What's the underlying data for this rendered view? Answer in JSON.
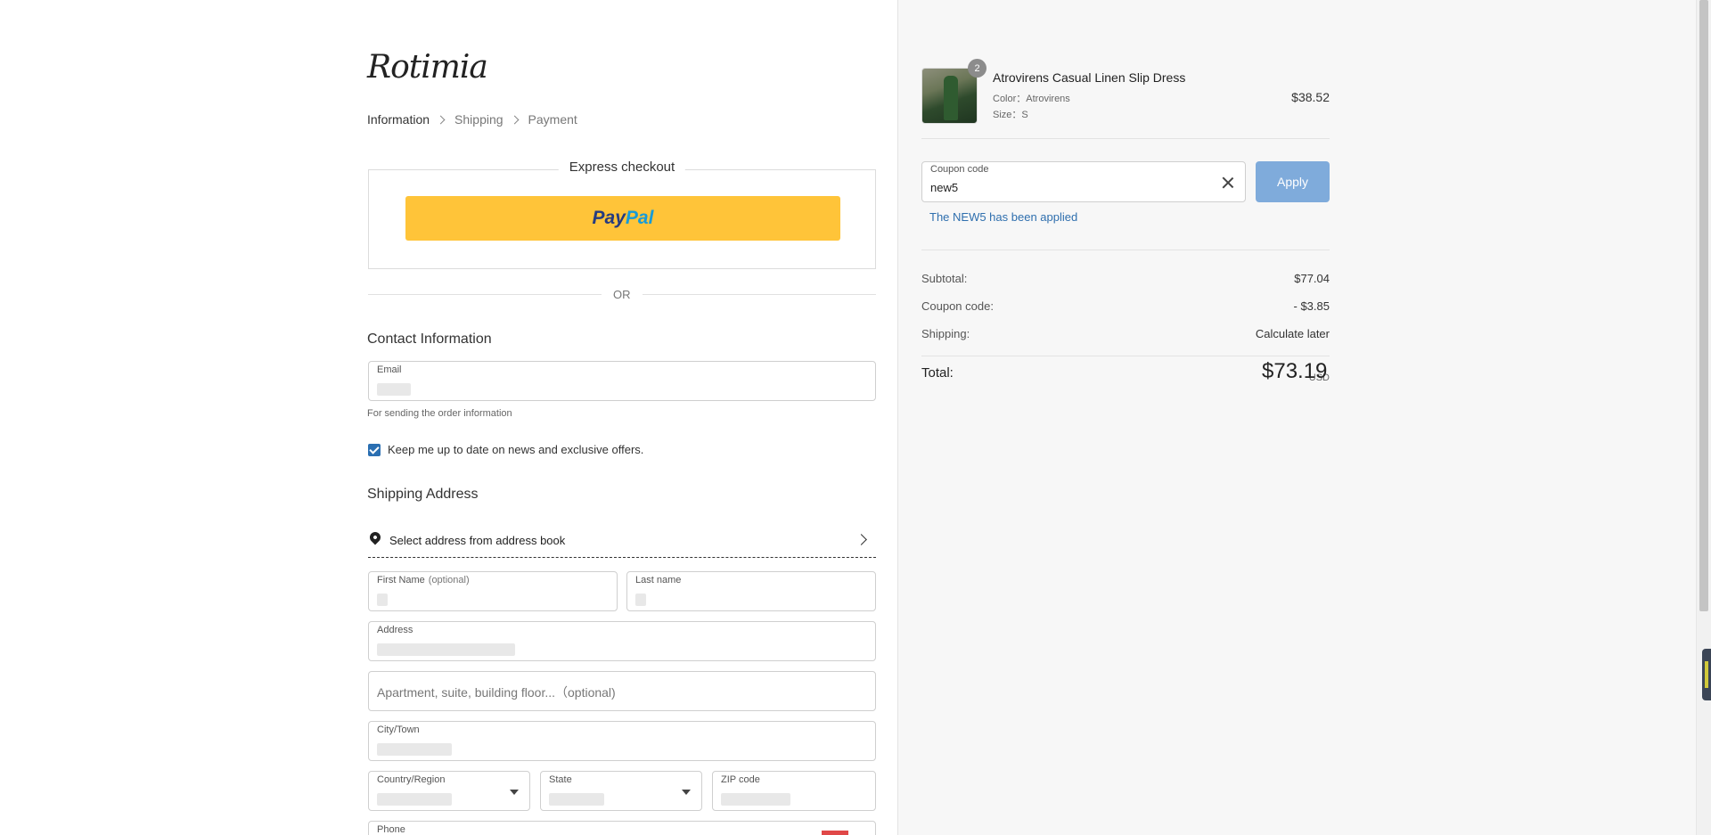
{
  "brand": {
    "logo_text": "Rotimia"
  },
  "breadcrumb": {
    "step1": "Information",
    "step2": "Shipping",
    "step3": "Payment"
  },
  "express": {
    "title": "Express checkout",
    "paypal_part1": "Pay",
    "paypal_part2": "Pal"
  },
  "divider": {
    "or_text": "OR"
  },
  "contact": {
    "title": "Contact Information",
    "email_label": "Email",
    "email_helper": "For sending the order information",
    "newsletter_label": "Keep me up to date on news and exclusive offers."
  },
  "shipping": {
    "title": "Shipping Address",
    "address_book_label": "Select address from address book",
    "first_name_label": "First Name",
    "first_name_optional": "(optional)",
    "last_name_label": "Last name",
    "address_label": "Address",
    "apartment_placeholder": "Apartment, suite, building floor...（optional)",
    "city_label": "City/Town",
    "country_label": "Country/Region",
    "state_label": "State",
    "zip_label": "ZIP code",
    "phone_label": "Phone"
  },
  "order": {
    "item": {
      "name": "Atrovirens Casual Linen Slip Dress",
      "quantity": "2",
      "color": "Color：Atrovirens",
      "size": "Size：S",
      "price": "$38.52"
    },
    "coupon": {
      "label": "Coupon code",
      "value": "new5",
      "apply_label": "Apply",
      "applied_message": "The NEW5 has been applied"
    },
    "summary": {
      "subtotal_label": "Subtotal:",
      "subtotal_value": "$77.04",
      "coupon_label": "Coupon code:",
      "coupon_value": "- $3.85",
      "shipping_label": "Shipping:",
      "shipping_value": "Calculate later",
      "total_label": "Total:",
      "total_currency": "USD",
      "total_value": "$73.19"
    }
  },
  "colors": {
    "paypal": "#ffc439",
    "apply_button": "#7fabdb",
    "link_blue": "#2f6fae",
    "checkbox": "#2a6fb2"
  }
}
